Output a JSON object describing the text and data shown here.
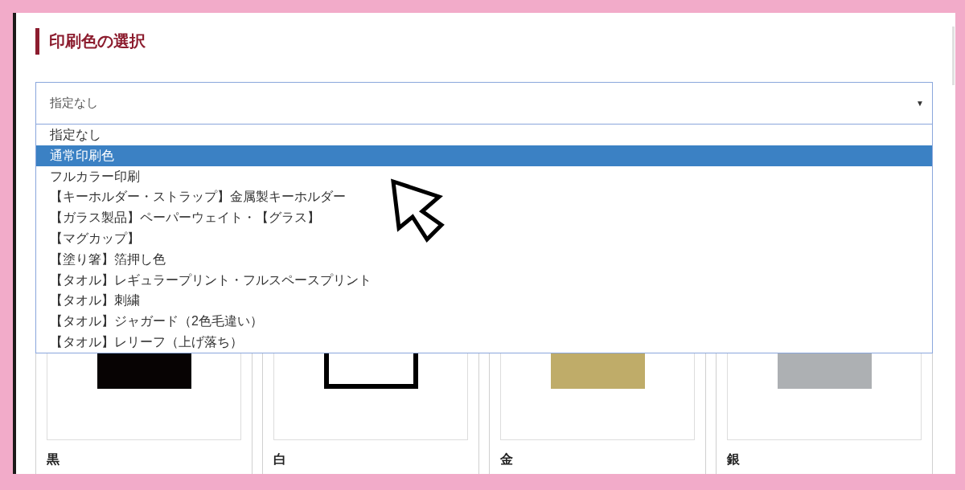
{
  "heading": "印刷色の選択",
  "select": {
    "value": "指定なし",
    "caret": "▼",
    "expanded": true
  },
  "options": [
    {
      "label": "指定なし",
      "selected": false
    },
    {
      "label": "通常印刷色",
      "selected": true
    },
    {
      "label": "フルカラー印刷",
      "selected": false
    },
    {
      "label": "【キーホルダー・ストラップ】金属製キーホルダー",
      "selected": false
    },
    {
      "label": "【ガラス製品】ペーパーウェイト・【グラス】",
      "selected": false
    },
    {
      "label": "【マグカップ】",
      "selected": false
    },
    {
      "label": "【塗り箸】箔押し色",
      "selected": false
    },
    {
      "label": "【タオル】レギュラープリント・フルスペースプリント",
      "selected": false
    },
    {
      "label": "【タオル】刺繍",
      "selected": false
    },
    {
      "label": "【タオル】ジャガード（2色毛違い）",
      "selected": false
    },
    {
      "label": "【タオル】レリーフ（上げ落ち）",
      "selected": false
    }
  ],
  "colors": [
    {
      "name": "黒",
      "kind": "solid",
      "color": "#070303"
    },
    {
      "name": "白",
      "kind": "outline",
      "color": "#ffffff"
    },
    {
      "name": "金",
      "kind": "solid",
      "color": "#bfac69"
    },
    {
      "name": "銀",
      "kind": "solid",
      "color": "#adb0b3"
    }
  ]
}
